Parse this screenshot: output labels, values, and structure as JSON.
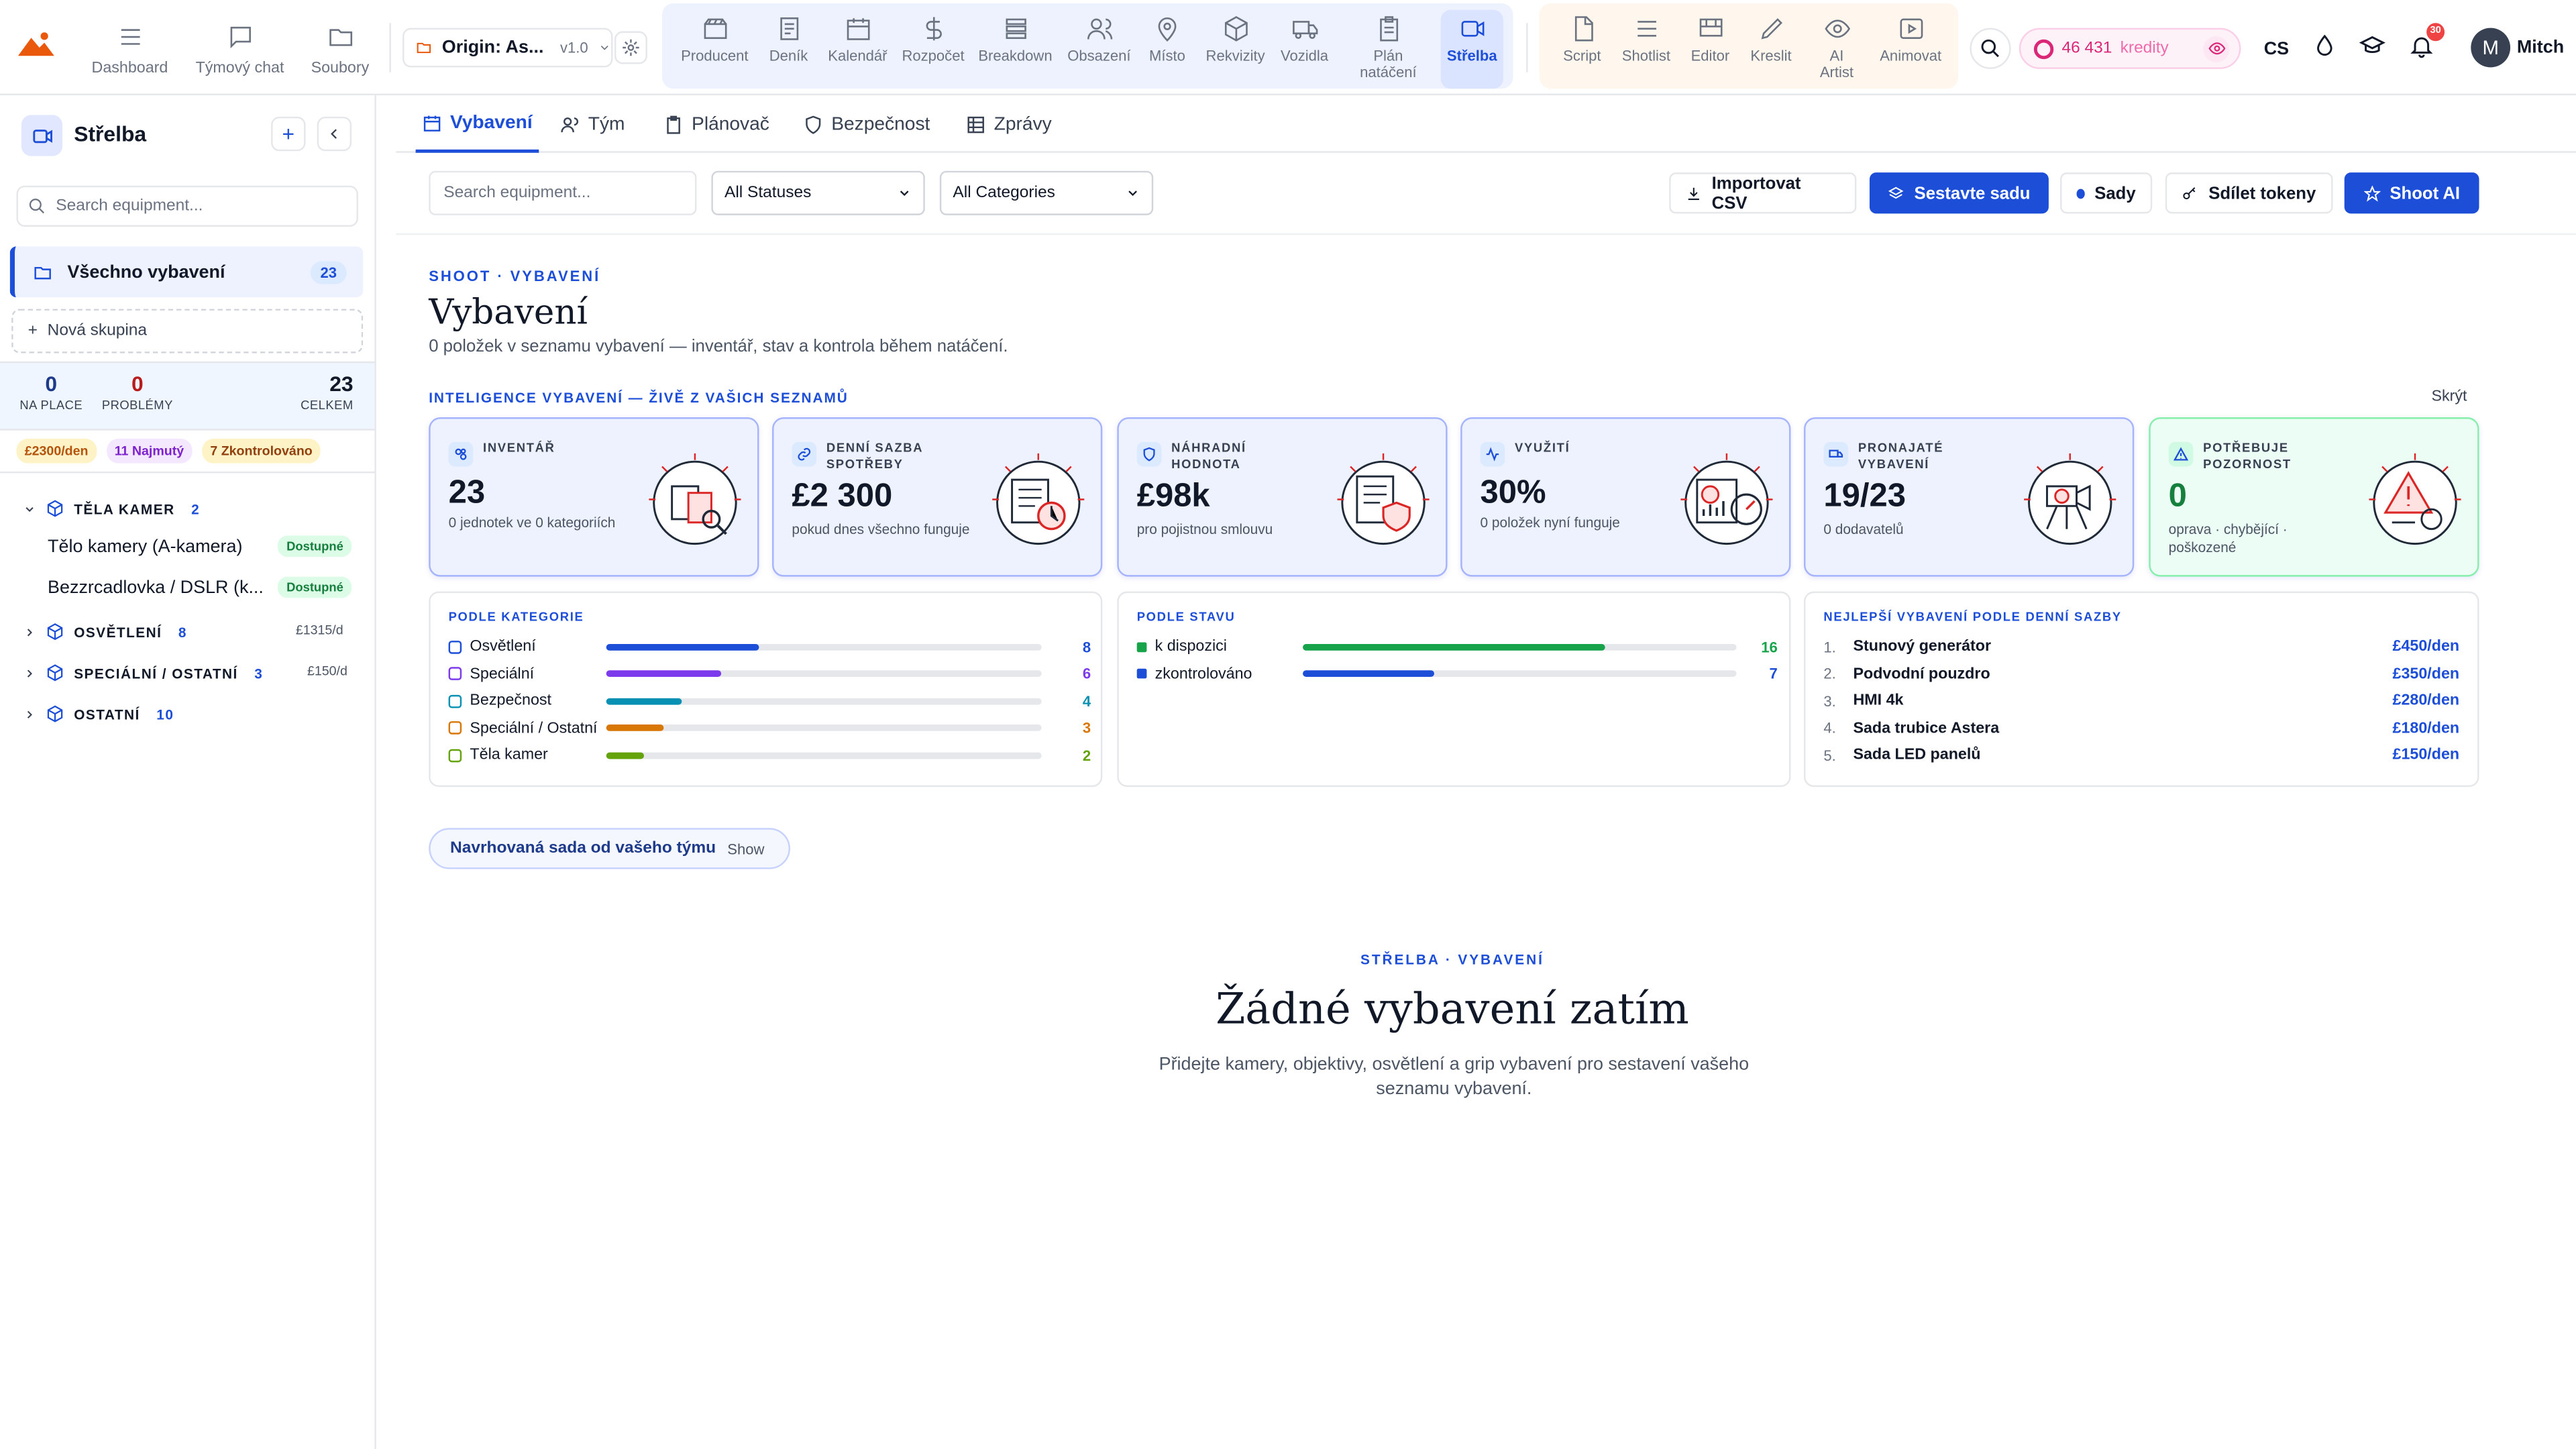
{
  "colors": {
    "accent": "#1d4ed8",
    "pink": "#db2777",
    "green": "#15803d",
    "red": "#dc2626"
  },
  "nav": {
    "left": [
      {
        "label": "Dashboard",
        "icon": "menu-icon"
      },
      {
        "label": "Týmový chat",
        "icon": "chat-icon"
      },
      {
        "label": "Soubory",
        "icon": "folder-icon"
      }
    ],
    "project": {
      "name": "Origin: As...",
      "version": "v1.0"
    },
    "tools": [
      {
        "label": "Producent",
        "icon": "clapper-icon"
      },
      {
        "label": "Deník",
        "icon": "journal-icon"
      },
      {
        "label": "Kalendář",
        "icon": "calendar-icon"
      },
      {
        "label": "Rozpočet",
        "icon": "dollar-icon"
      },
      {
        "label": "Breakdown",
        "icon": "list-icon"
      },
      {
        "label": "Obsazení",
        "icon": "users-icon"
      },
      {
        "label": "Místo",
        "icon": "location-icon"
      },
      {
        "label": "Rekvizity",
        "icon": "box-icon"
      },
      {
        "label": "Vozidla",
        "icon": "truck-icon"
      },
      {
        "label": "Plán natáčení",
        "icon": "clipboard-icon"
      },
      {
        "label": "Střelba",
        "icon": "camera-icon"
      }
    ],
    "creative": [
      {
        "label": "Script",
        "icon": "script-icon"
      },
      {
        "label": "Shotlist",
        "icon": "lines-icon"
      },
      {
        "label": "Editor",
        "icon": "editor-icon"
      },
      {
        "label": "Kreslit",
        "icon": "pencil-icon"
      },
      {
        "label": "AI Artist",
        "icon": "eye-icon"
      },
      {
        "label": "Animovat",
        "icon": "play-icon"
      }
    ],
    "credits_value": "46 431",
    "credits_label": "kredity",
    "language": "CS",
    "notifications": "30",
    "user_initial": "M",
    "user_name": "Mitch"
  },
  "sidebar": {
    "title": "Střelba",
    "search_placeholder": "Search equipment...",
    "all_label": "Všechno vybavení",
    "all_count": "23",
    "new_group": "Nová skupina",
    "stats": [
      {
        "value": "0",
        "label": "NA PLACE",
        "color": "#1e3a8a"
      },
      {
        "value": "0",
        "label": "PROBLÉMY",
        "color": "#b91c1c"
      },
      {
        "value": "23",
        "label": "CELKEM",
        "color": "#111827"
      }
    ],
    "chips": [
      {
        "text": "£2300/den",
        "bg": "#fef3c7",
        "fg": "#b45309"
      },
      {
        "text": "11 Najmutý",
        "bg": "#f3e8ff",
        "fg": "#7e22ce"
      },
      {
        "text": "7 Zkontrolováno",
        "bg": "#fef3c7",
        "fg": "#92400e"
      }
    ],
    "groups": [
      {
        "name": "TĚLA KAMER",
        "count": "2",
        "rate": "",
        "open": true,
        "items": [
          {
            "name": "Tělo kamery (A-kamera)",
            "status": "Dostupné"
          },
          {
            "name": "Bezzrcadlovka / DSLR (k...",
            "status": "Dostupné"
          }
        ]
      },
      {
        "name": "OSVĚTLENÍ",
        "count": "8",
        "rate": "£1315/d",
        "open": false,
        "items": []
      },
      {
        "name": "SPECIÁLNÍ / OSTATNÍ",
        "count": "3",
        "rate": "£150/d",
        "open": false,
        "items": []
      },
      {
        "name": "OSTATNÍ",
        "count": "10",
        "rate": "",
        "open": false,
        "items": []
      }
    ]
  },
  "tabs": [
    {
      "label": "Vybavení",
      "icon": "calendar-icon",
      "active": true
    },
    {
      "label": "Tým",
      "icon": "users-icon",
      "active": false
    },
    {
      "label": "Plánovač",
      "icon": "clipboard-icon",
      "active": false
    },
    {
      "label": "Bezpečnost",
      "icon": "shield-icon",
      "active": false
    },
    {
      "label": "Zprávy",
      "icon": "table-icon",
      "active": false
    }
  ],
  "filters": {
    "search_placeholder": "Search equipment...",
    "status_select": "All Statuses",
    "category_select": "All Categories",
    "buttons": {
      "import": "Importovat CSV",
      "build_kit": "Sestavte sadu",
      "kits": "Sady",
      "share": "Sdílet tokeny",
      "shoot_ai": "Shoot AI"
    }
  },
  "header": {
    "eyebrow": "SHOOT · VYBAVENÍ",
    "title": "Vybavení",
    "subtitle": "0 položek v seznamu vybavení — inventář, stav a kontrola během natáčení."
  },
  "intel": {
    "eyebrow": "INTELIGENCE VYBAVENÍ — ŽIVĚ Z VAŠICH SEZNAMŮ",
    "hide": "Skrýt",
    "kpis": [
      {
        "label": "INVENTÁŘ",
        "value": "23",
        "sub": "0 jednotek ve 0 kategoriích",
        "green": false,
        "icon": "inventory-icon"
      },
      {
        "label": "DENNÍ SAZBA SPOTŘEBY",
        "value": "£2 300",
        "sub": "pokud dnes všechno funguje",
        "green": false,
        "icon": "link-icon"
      },
      {
        "label": "NÁHRADNÍ HODNOTA",
        "value": "£98k",
        "sub": "pro pojistnou smlouvu",
        "green": false,
        "icon": "shield-icon"
      },
      {
        "label": "VYUŽITÍ",
        "value": "30%",
        "sub": "0 položek nyní funguje",
        "green": false,
        "icon": "activity-icon"
      },
      {
        "label": "PRONAJATÉ VYBAVENÍ",
        "value": "19/23",
        "sub": "0 dodavatelů",
        "green": false,
        "icon": "truck-icon"
      },
      {
        "label": "POTŘEBUJE POZORNOST",
        "value": "0",
        "sub": "oprava · chybějící · poškozené",
        "green": true,
        "icon": "warning-icon"
      }
    ],
    "by_category": {
      "title": "PODLE KATEGORIE",
      "rows": [
        {
          "label": "Osvětlení",
          "count": 8,
          "color": "#1d4ed8",
          "icon": "bulb-icon"
        },
        {
          "label": "Speciální",
          "count": 6,
          "color": "#7c3aed",
          "icon": "cube-icon"
        },
        {
          "label": "Bezpečnost",
          "count": 4,
          "color": "#0891b2",
          "icon": "cube-icon"
        },
        {
          "label": "Speciální / Ostatní",
          "count": 3,
          "color": "#d97706",
          "icon": "cube-icon"
        },
        {
          "label": "Těla kamer",
          "count": 2,
          "color": "#65a30d",
          "icon": "camera-icon"
        }
      ]
    },
    "by_status": {
      "title": "PODLE STAVU",
      "rows": [
        {
          "label": "k dispozici",
          "count": 16,
          "color": "#16a34a"
        },
        {
          "label": "zkontrolováno",
          "count": 7,
          "color": "#1d4ed8"
        }
      ]
    },
    "top_rate": {
      "title": "NEJLEPŠÍ VYBAVENÍ PODLE DENNÍ SAZBY",
      "rows": [
        {
          "idx": "1.",
          "name": "Stunový generátor",
          "rate": "£450/den"
        },
        {
          "idx": "2.",
          "name": "Podvodní pouzdro",
          "rate": "£350/den"
        },
        {
          "idx": "3.",
          "name": "HMI 4k",
          "rate": "£280/den"
        },
        {
          "idx": "4.",
          "name": "Sada trubice Astera",
          "rate": "£180/den"
        },
        {
          "idx": "5.",
          "name": "Sada LED panelů",
          "rate": "£150/den"
        }
      ]
    }
  },
  "suggest": {
    "label": "Navrhovaná sada od vašeho týmu",
    "action": "Show"
  },
  "empty": {
    "eyebrow": "STŘELBA · VYBAVENÍ",
    "title": "Žádné vybavení zatím",
    "subtitle": "Přidejte kamery, objektivy, osvětlení a grip vybavení pro sestavení vašeho seznamu vybavení."
  }
}
